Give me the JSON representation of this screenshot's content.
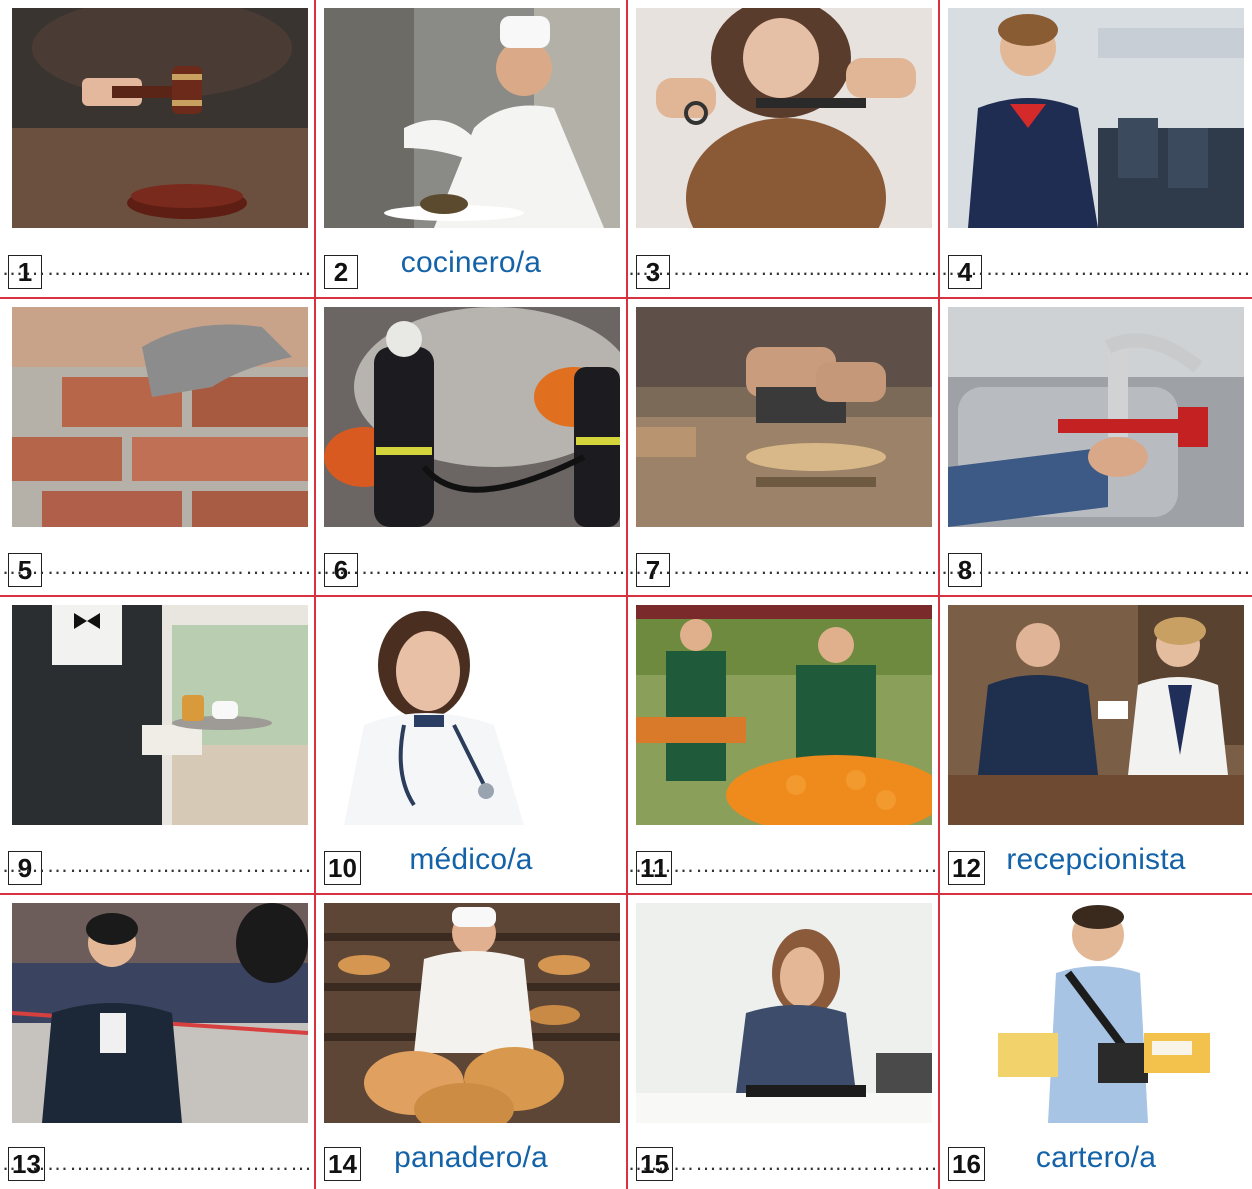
{
  "blank_placeholder": "…………...……..........…………",
  "cards": [
    {
      "number": "1",
      "answer": "",
      "photo": "judge-gavel-photo"
    },
    {
      "number": "2",
      "answer": "cocinero/a",
      "photo": "chef-photo"
    },
    {
      "number": "3",
      "answer": "",
      "photo": "hairdresser-photo"
    },
    {
      "number": "4",
      "answer": "",
      "photo": "flight-attendant-photo"
    },
    {
      "number": "5",
      "answer": "",
      "photo": "bricklayer-photo"
    },
    {
      "number": "6",
      "answer": "",
      "photo": "firefighter-photo"
    },
    {
      "number": "7",
      "answer": "",
      "photo": "carpenter-photo"
    },
    {
      "number": "8",
      "answer": "",
      "photo": "plumber-photo"
    },
    {
      "number": "9",
      "answer": "",
      "photo": "waiter-photo"
    },
    {
      "number": "10",
      "answer": "médico/a",
      "photo": "doctor-photo"
    },
    {
      "number": "11",
      "answer": "",
      "photo": "greengrocer-photo"
    },
    {
      "number": "12",
      "answer": "recepcionista",
      "photo": "receptionist-photo"
    },
    {
      "number": "13",
      "answer": "",
      "photo": "journalist-photo"
    },
    {
      "number": "14",
      "answer": "panadero/a",
      "photo": "baker-photo"
    },
    {
      "number": "15",
      "answer": "",
      "photo": "secretary-photo"
    },
    {
      "number": "16",
      "answer": "cartero/a",
      "photo": "postman-photo"
    }
  ],
  "colors": {
    "grid_border": "#d8313f",
    "answer_text": "#1463a8"
  }
}
